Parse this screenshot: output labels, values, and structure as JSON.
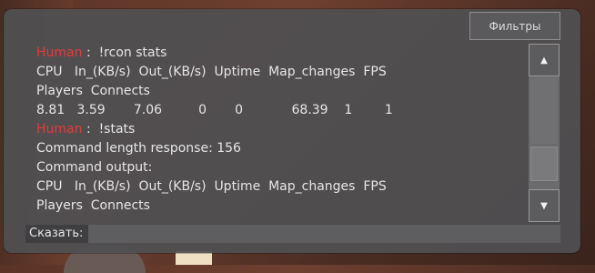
{
  "toolbar": {
    "filters_label": "Фильтры"
  },
  "console": {
    "lines": [
      {
        "name": "Human",
        "text": " :  !rcon stats"
      },
      {
        "name": "",
        "text": "CPU   In_(KB/s)  Out_(KB/s)  Uptime  Map_changes  FPS"
      },
      {
        "name": "",
        "text": "Players  Connects"
      },
      {
        "name": "",
        "text": "8.81   3.59       7.06         0       0            68.39    1        1"
      },
      {
        "name": "Human",
        "text": " :  !stats"
      },
      {
        "name": "",
        "text": "Command length response: 156"
      },
      {
        "name": "",
        "text": "Command output:"
      },
      {
        "name": "",
        "text": "CPU   In_(KB/s)  Out_(KB/s)  Uptime  Map_changes  FPS"
      },
      {
        "name": "",
        "text": "Players  Connects"
      }
    ]
  },
  "scrollbar": {
    "up_icon": "▲",
    "down_icon": "▼"
  },
  "say": {
    "label": "Сказать:",
    "value": ""
  },
  "colors": {
    "player_name": "#e03c3c",
    "panel": "#505052"
  }
}
